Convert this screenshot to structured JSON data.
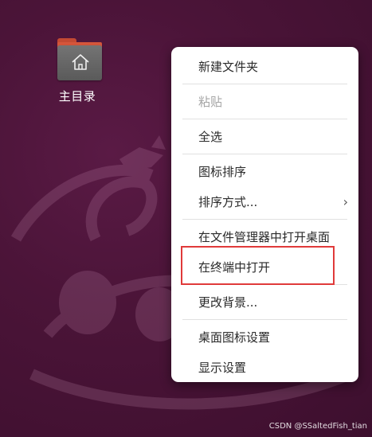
{
  "desktop": {
    "home_folder_label": "主目录"
  },
  "context_menu": {
    "items": [
      {
        "label": "新建文件夹",
        "disabled": false
      },
      {
        "label": "粘贴",
        "disabled": true
      },
      {
        "label": "全选",
        "disabled": false
      },
      {
        "label": "图标排序",
        "disabled": false
      },
      {
        "label": "排序方式...",
        "disabled": false,
        "has_submenu": true
      },
      {
        "label": "在文件管理器中打开桌面",
        "disabled": false
      },
      {
        "label": "在终端中打开",
        "disabled": false,
        "highlighted": true
      },
      {
        "label": "更改背景...",
        "disabled": false
      },
      {
        "label": "桌面图标设置",
        "disabled": false
      },
      {
        "label": "显示设置",
        "disabled": false
      }
    ],
    "submenu_chevron": "›"
  },
  "watermark": "CSDN @SSaltedFish_tian",
  "colors": {
    "desktop_bg": "#4b1438",
    "highlight": "#e03a3a",
    "disabled_text": "#a5a5a5"
  },
  "icons": {
    "home_folder": "home-folder-icon",
    "submenu": "chevron-right-icon"
  }
}
